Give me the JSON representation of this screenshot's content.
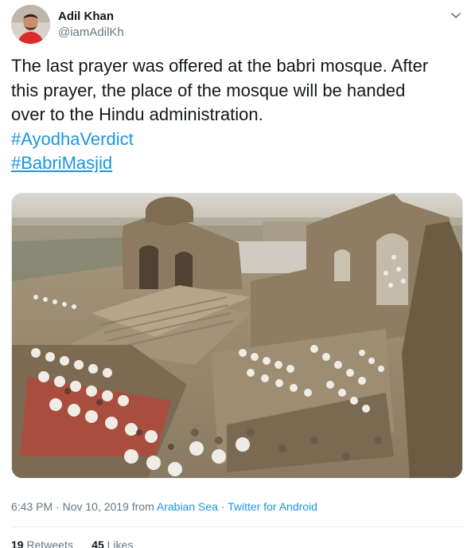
{
  "author": {
    "name": "Adil Khan",
    "handle": "@iamAdilKh"
  },
  "tweet": {
    "lines": [
      "The last prayer was offered at the babri mosque. After",
      "this prayer, the place of the mosque will be handed",
      "over to the Hindu administration."
    ],
    "hashtags": [
      "#AyodhaVerdict",
      "#BabriMasjid"
    ]
  },
  "meta": {
    "timestamp": "6:43 PM · Nov 10, 2019 from ",
    "location": "Arabian Sea",
    "separator": " · ",
    "source": "Twitter for Android"
  },
  "stats": {
    "retweets_count": "19",
    "retweets_label": "Retweets",
    "likes_count": "45",
    "likes_label": "Likes"
  },
  "icons": {
    "menu": "chevron-down-icon"
  },
  "colors": {
    "link": "#1b95e0",
    "secondary": "#657786",
    "text": "#14171a"
  }
}
